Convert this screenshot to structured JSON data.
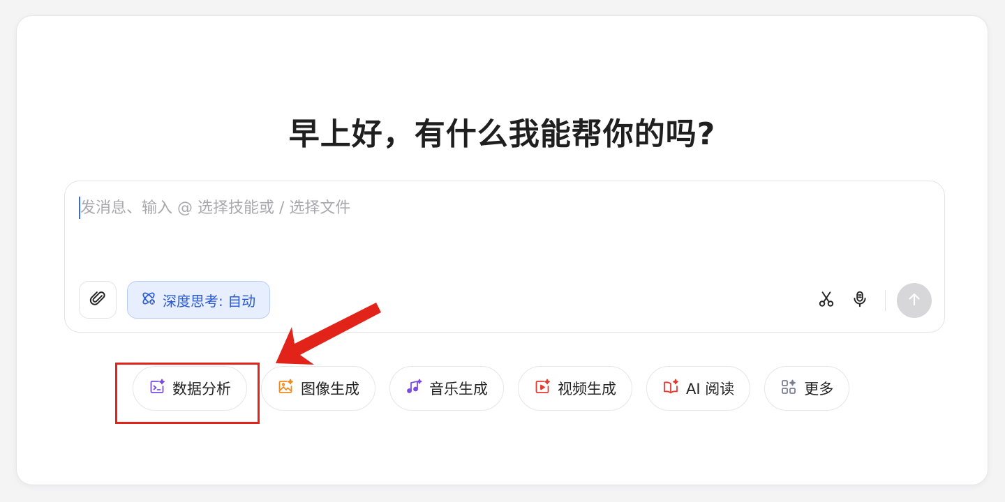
{
  "greeting": "早上好，有什么我能帮你的吗?",
  "composer": {
    "placeholder": "发消息、输入 @ 选择技能或 / 选择文件",
    "value": ""
  },
  "toolbar": {
    "attach_icon": "paperclip-icon",
    "deep_thinking_label": "深度思考: 自动",
    "deep_thinking_icon": "atom-icon",
    "scissors_icon": "scissors-icon",
    "mic_icon": "microphone-icon",
    "send_icon": "arrow-up-icon"
  },
  "chips": [
    {
      "label": "数据分析",
      "icon": "data-analysis-icon",
      "color": "#7b4be0"
    },
    {
      "label": "图像生成",
      "icon": "image-spark-icon",
      "color": "#f08a1c"
    },
    {
      "label": "音乐生成",
      "icon": "music-note-icon",
      "color": "#7b4be0"
    },
    {
      "label": "视频生成",
      "icon": "video-spark-icon",
      "color": "#e5392f"
    },
    {
      "label": "AI 阅读",
      "icon": "book-spark-icon",
      "color": "#e5392f"
    },
    {
      "label": "更多",
      "icon": "grid-plus-icon",
      "color": "#7b7f95"
    }
  ],
  "colors": {
    "accent": "#2958d8",
    "annotation": "#e2231a",
    "send_disabled": "#d7d7d9"
  }
}
